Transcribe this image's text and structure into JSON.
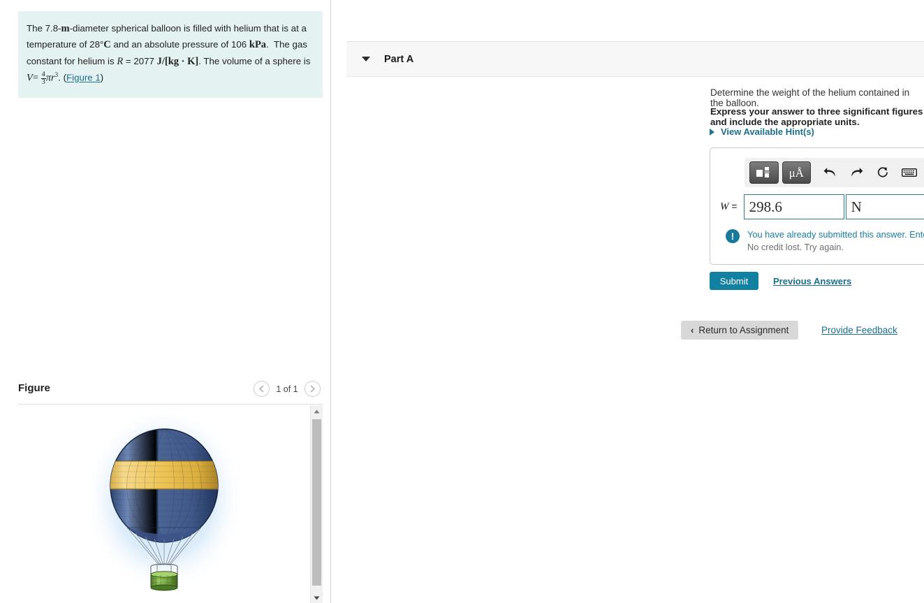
{
  "problem": {
    "segments": [
      {
        "t": "The 7.8-",
        "style": "plain"
      },
      {
        "t": "m",
        "style": "bold"
      },
      {
        "t": "-diameter spherical balloon is filled with helium that is at a temperature of 28",
        "style": "plain"
      },
      {
        "t": "°",
        "style": "plain"
      },
      {
        "t": "C",
        "style": "bold"
      },
      {
        "t": " and an absolute pressure of 106 ",
        "style": "plain"
      },
      {
        "t": "kPa",
        "style": "bold"
      },
      {
        "t": ".  The gas constant for helium is ",
        "style": "plain"
      },
      {
        "t": "R",
        "style": "var"
      },
      {
        "t": " = 2077 ",
        "style": "plain"
      },
      {
        "t": "J/[kg · K]",
        "style": "bold"
      },
      {
        "t": ". The volume of a sphere is ",
        "style": "plain"
      }
    ],
    "full_text": "The 7.8-m-diameter spherical balloon is filled with helium that is at a temperature of 28°C and an absolute pressure of 106 kPa.  The gas constant for helium is R = 2077 J/[kg · K]. The volume of a sphere is V= 4/3 πr³. (Figure 1)",
    "volume_var": "V",
    "volume_eq": "=",
    "frac_num": "4",
    "frac_den": "3",
    "pi_r": "πr",
    "exponent": "3",
    "period": ".",
    "figure_link_open": "(",
    "figure_link": "Figure 1",
    "figure_link_close": ")"
  },
  "figure": {
    "title": "Figure",
    "pager_label": "1 of 1",
    "prev_icon": "chevron-left-icon",
    "next_icon": "chevron-right-icon",
    "image_alt": "hot air balloon with blue envelope and yellow stripe"
  },
  "part": {
    "title": "Part A",
    "caret_icon": "caret-down-icon",
    "question": "Determine the weight of the helium contained in the balloon.",
    "instruction": "Express your answer to three significant figures and include the appropriate units.",
    "hints_label": "View Available Hint(s)",
    "hints_caret_icon": "caret-right-icon"
  },
  "mathbar": {
    "template_icon": "math-template-icon",
    "units_label": "μÅ",
    "undo_icon": "undo-arrow-icon",
    "redo_icon": "redo-arrow-icon",
    "reset_icon": "reset-circle-icon",
    "keyboard_icon": "keyboard-icon",
    "help_label": "?"
  },
  "answer": {
    "label_var": "W",
    "label_eq": "=",
    "value": "298.6",
    "value_placeholder": "",
    "units": "N",
    "units_placeholder": ""
  },
  "feedback": {
    "icon": "exclamation-circle-icon",
    "primary": "You have already submitted this answer. Enter a new answer.",
    "secondary": "No credit lost. Try again."
  },
  "actions": {
    "submit_label": "Submit",
    "previous_answers_label": "Previous Answers",
    "return_label": "Return to Assignment",
    "return_chevron": "‹",
    "provide_feedback_label": "Provide Feedback"
  },
  "colors": {
    "problem_bg": "#e4f2f2",
    "accent_teal": "#1a6f8b",
    "submit_bg": "#1280a0",
    "input_border": "#2b7e92",
    "part_header_bg": "#f7f7f7",
    "feedback_icon_bg": "#17799b"
  }
}
